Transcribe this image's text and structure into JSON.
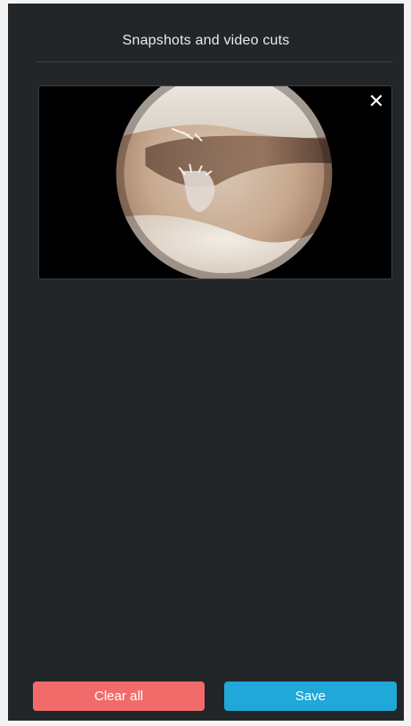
{
  "panel": {
    "title": "Snapshots and video cuts"
  },
  "snapshots": [
    {
      "type": "arthroscopy-image",
      "close_icon": "close-icon",
      "close_glyph": "✕"
    }
  ],
  "footer": {
    "clear_label": "Clear all",
    "save_label": "Save"
  },
  "colors": {
    "panel_bg": "#232629",
    "clear_button": "#f16b6b",
    "save_button": "#1fa8d8",
    "text": "#e9ecef"
  }
}
